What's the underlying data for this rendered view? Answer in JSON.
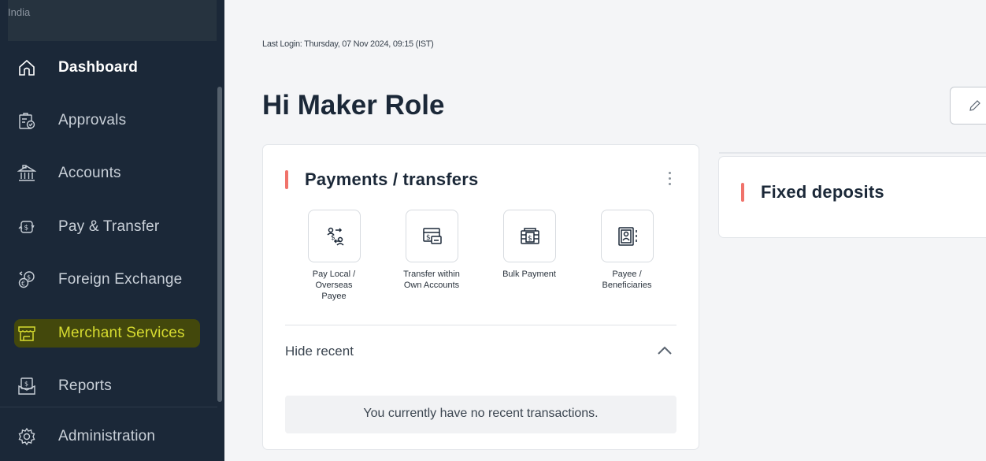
{
  "sidebar": {
    "country": "India",
    "items": [
      {
        "label": "Dashboard",
        "icon": "home-icon"
      },
      {
        "label": "Approvals",
        "icon": "approvals-icon"
      },
      {
        "label": "Accounts",
        "icon": "bank-icon"
      },
      {
        "label": "Pay & Transfer",
        "icon": "pay-transfer-icon"
      },
      {
        "label": "Foreign Exchange",
        "icon": "foreign-exchange-icon"
      },
      {
        "label": "Merchant Services",
        "icon": "merchant-store-icon"
      },
      {
        "label": "Reports",
        "icon": "reports-icon"
      },
      {
        "label": "Administration",
        "icon": "gear-icon"
      }
    ],
    "active": "Dashboard",
    "highlighted": "Merchant Services",
    "highlight_color": "#d7dc30"
  },
  "header": {
    "last_login": "Last Login: Thursday, 07 Nov 2024, 09:15 (IST)",
    "greeting": "Hi Maker Role"
  },
  "payments_card": {
    "title": "Payments / transfers",
    "actions": [
      {
        "label": "Pay Local / Overseas Payee",
        "icon": "pay-payee-icon"
      },
      {
        "label": "Transfer within Own Accounts",
        "icon": "own-transfer-icon"
      },
      {
        "label": "Bulk Payment",
        "icon": "bulk-payment-icon"
      },
      {
        "label": "Payee / Beneficiaries",
        "icon": "payee-book-icon"
      }
    ],
    "hide_recent": "Hide recent",
    "empty_message": "You currently have no recent transactions."
  },
  "fixed_deposits_card": {
    "title": "Fixed deposits"
  },
  "colors": {
    "sidebar_bg": "#1b2838",
    "accent": "#f0736b"
  }
}
